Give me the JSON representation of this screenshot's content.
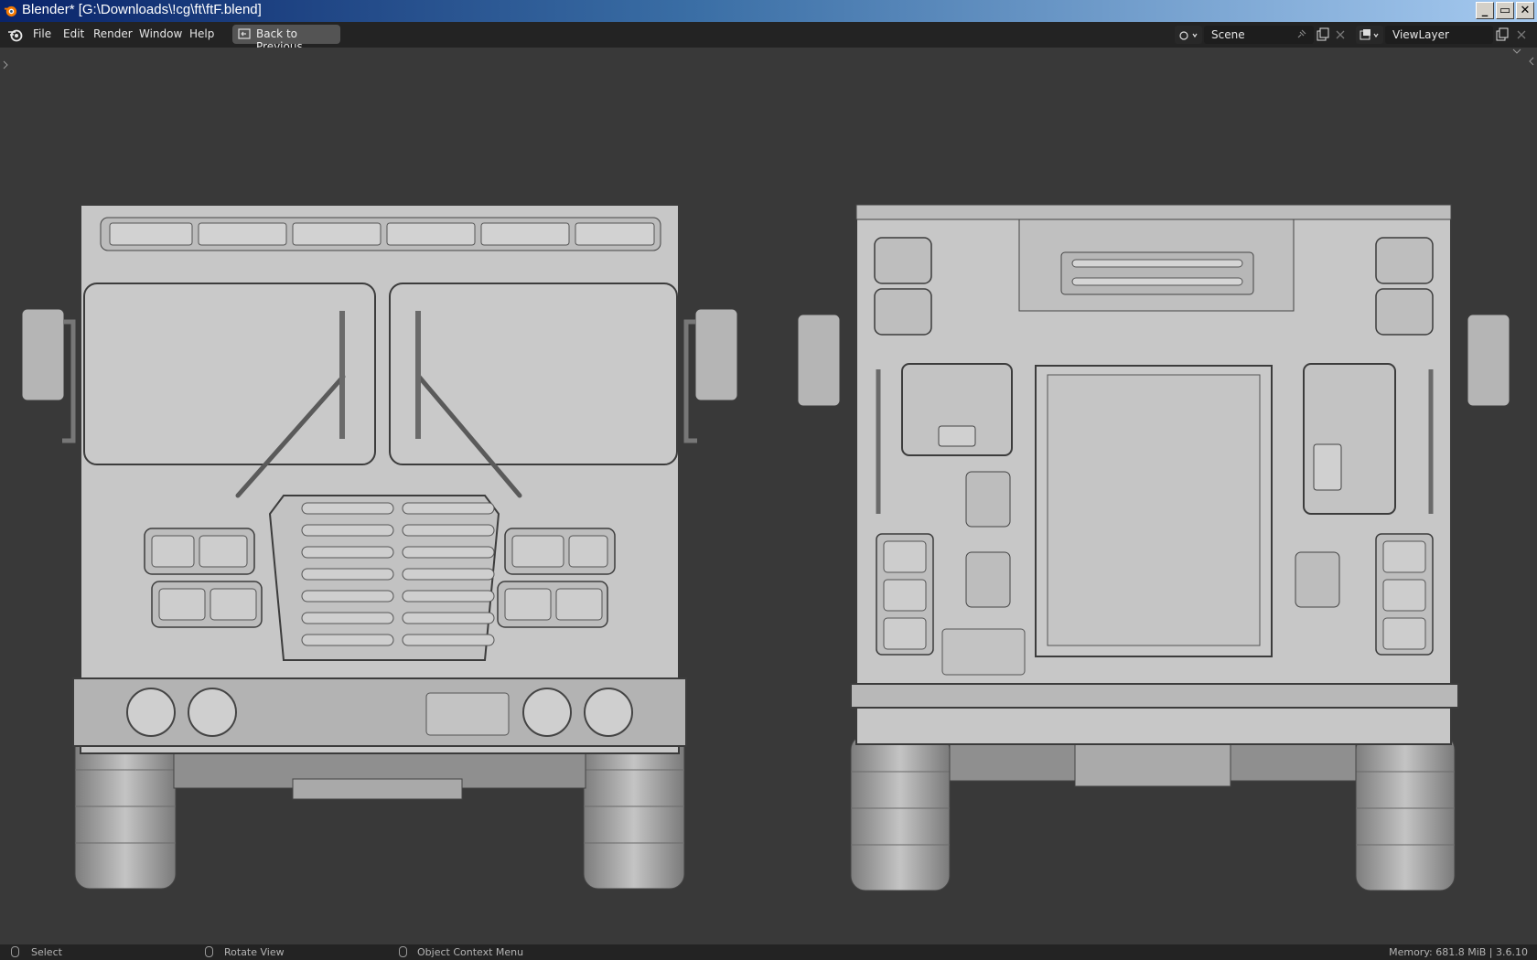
{
  "window": {
    "title": "Blender* [G:\\Downloads\\!cg\\ft\\ftF.blend]"
  },
  "window_controls": {
    "minimize": "_",
    "maximize": "▭",
    "close": "✕"
  },
  "menubar": {
    "items": [
      "File",
      "Edit",
      "Render",
      "Window",
      "Help"
    ],
    "back_button": "Back to Previous",
    "scene_field": "Scene",
    "view_layer_field": "ViewLayer"
  },
  "viewport": {
    "background": "#393939",
    "views": [
      "front-view",
      "rear-view"
    ]
  },
  "statusbar": {
    "select": "Select",
    "rotate": "Rotate View",
    "context_menu": "Object Context Menu",
    "memory": "Memory: 681.8 MiB | 3.6.10"
  },
  "colors": {
    "accent": "#3a6ea5",
    "panel": "#232323",
    "model": "#c8c8c8"
  }
}
